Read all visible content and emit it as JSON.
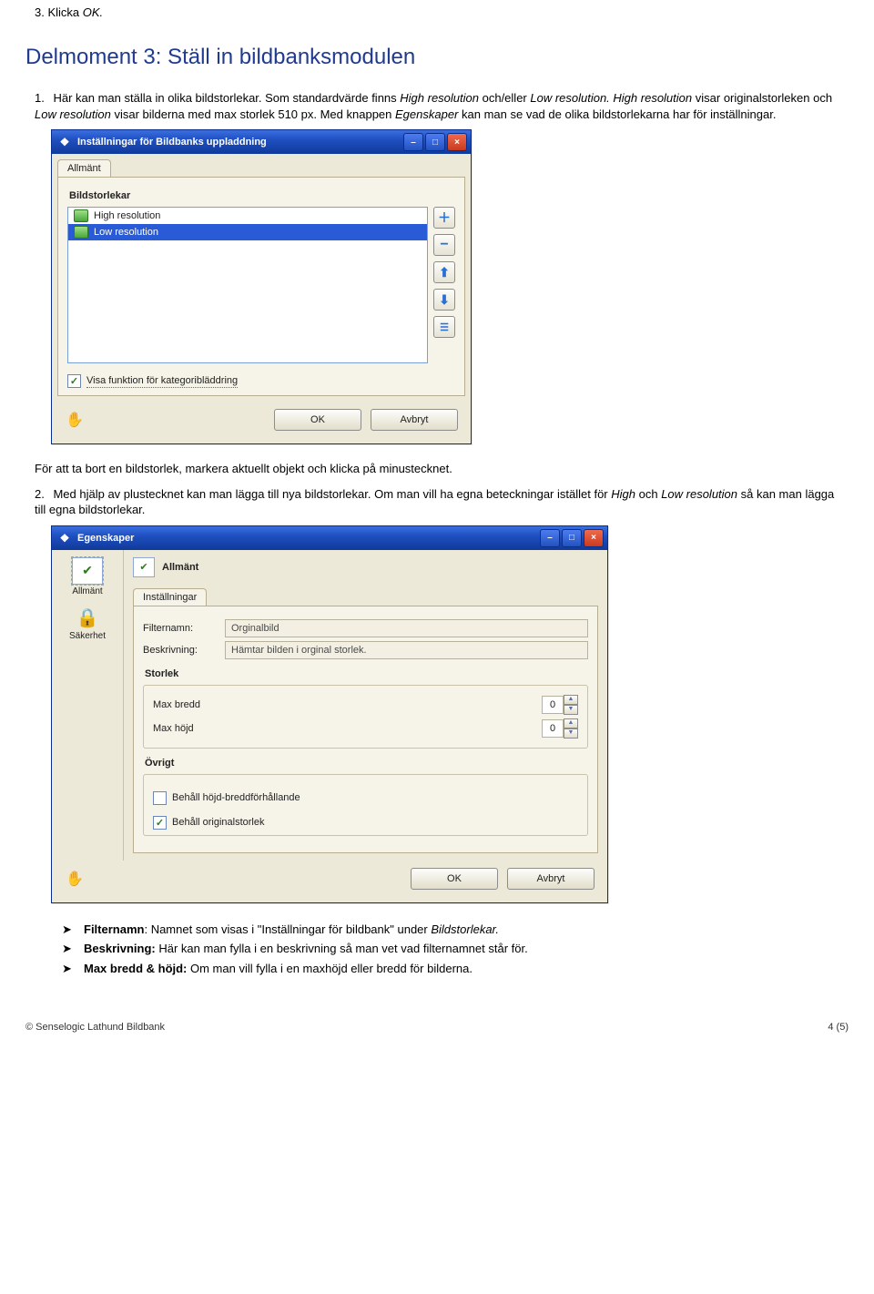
{
  "step3_prefix": "3. Klicka ",
  "step3_ok": "OK.",
  "section_title": "Delmoment 3: Ställ in bildbanksmodulen",
  "para1": {
    "num": "1.",
    "t1": "Här kan man ställa in olika bildstorlekar. Som standardvärde finns ",
    "i1": "High resolution",
    "t2": " och/eller ",
    "i2": "Low resolution. High resolution",
    "t3": " visar originalstorleken och ",
    "i3": "Low resolution",
    "t4": " visar bilderna med max storlek 510 px. Med knappen ",
    "i4": "Egenskaper",
    "t5": " kan man se vad de olika bildstorlekarna har för inställningar."
  },
  "win1": {
    "title": "Inställningar för Bildbanks uppladdning",
    "tab": "Allmänt",
    "group": "Bildstorlekar",
    "items": [
      "High resolution",
      "Low resolution"
    ],
    "checkbox": "Visa funktion för kategoribläddring",
    "ok": "OK",
    "cancel": "Avbryt"
  },
  "mid_text": "För att ta bort en bildstorlek, markera aktuellt objekt och klicka på minustecknet.",
  "para2": {
    "num": "2.",
    "t1": "Med hjälp av plustecknet kan man lägga till nya bildstorlekar. Om man vill ha egna beteckningar istället för ",
    "i1": "High",
    "t2": " och ",
    "i2": "Low resolution",
    "t3": " så kan man lägga till egna bildstorlekar."
  },
  "win2": {
    "title": "Egenskaper",
    "side_allmant": "Allmänt",
    "side_sakerhet": "Säkerhet",
    "header": "Allmänt",
    "tab": "Inställningar",
    "filternamn_label": "Filternamn:",
    "filternamn_value": "Orginalbild",
    "beskrivning_label": "Beskrivning:",
    "beskrivning_value": "Hämtar bilden i orginal storlek.",
    "storlek_group": "Storlek",
    "max_bredd": "Max bredd",
    "max_hojd": "Max höjd",
    "spin_val": "0",
    "ovrigt_group": "Övrigt",
    "chk_ratio": "Behåll höjd-breddförhållande",
    "chk_orig": "Behåll originalstorlek",
    "ok": "OK",
    "cancel": "Avbryt"
  },
  "bullets": {
    "b1_bold": "Filternamn",
    "b1_rest": ": Namnet som visas i \"Inställningar för bildbank\" under ",
    "b1_italic": "Bildstorlekar.",
    "b2_bold": "Beskrivning:",
    "b2_rest": " Här kan man fylla i en beskrivning så man vet vad filternamnet står för.",
    "b3_bold": "Max bredd & höjd:",
    "b3_rest": " Om man vill fylla i en maxhöjd eller bredd för bilderna."
  },
  "footer": {
    "left": "© Senselogic Lathund Bildbank",
    "right": "4 (5)"
  }
}
